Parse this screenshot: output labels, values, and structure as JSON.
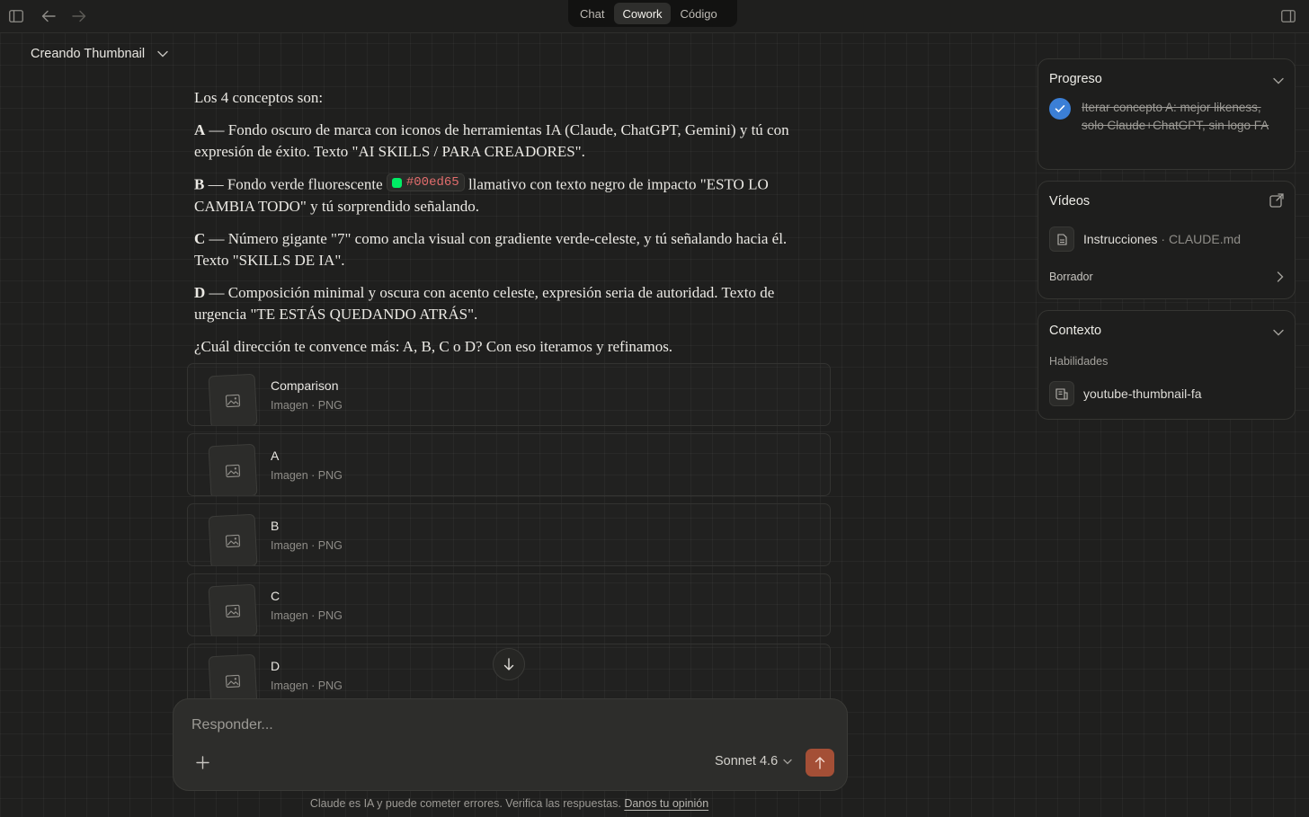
{
  "topbar": {
    "tabs": [
      {
        "label": "Chat",
        "active": false
      },
      {
        "label": "Cowork",
        "active": true
      },
      {
        "label": "Código",
        "active": false
      }
    ]
  },
  "conversation": {
    "title": "Creando Thumbnail"
  },
  "message": {
    "intro": "Los 4 conceptos son:",
    "concepts": [
      {
        "letter": "A",
        "text": " — Fondo oscuro de marca con iconos de herramientas IA (Claude, ChatGPT, Gemini) y tú con expresión de éxito. Texto \"AI SKILLS / PARA CREADORES\"."
      },
      {
        "letter": "B",
        "text_before": " — Fondo verde fluorescente ",
        "code": "#00ed65",
        "code_color": "#00ed65",
        "text_after": " llamativo con texto negro de impacto \"ESTO LO CAMBIA TODO\" y tú sorprendido señalando."
      },
      {
        "letter": "C",
        "text": " — Número gigante \"7\" como ancla visual con gradiente verde-celeste, y tú señalando hacia él. Texto \"SKILLS DE IA\"."
      },
      {
        "letter": "D",
        "text": " — Composición minimal y oscura con acento celeste, expresión seria de autoridad. Texto de urgencia \"TE ESTÁS QUEDANDO ATRÁS\"."
      }
    ],
    "question": "¿Cuál dirección te convence más: A, B, C o D? Con eso iteramos y refinamos."
  },
  "attachments": [
    {
      "name": "Comparison",
      "meta": "Imagen · PNG"
    },
    {
      "name": "A",
      "meta": "Imagen · PNG"
    },
    {
      "name": "B",
      "meta": "Imagen · PNG"
    },
    {
      "name": "C",
      "meta": "Imagen · PNG"
    },
    {
      "name": "D",
      "meta": "Imagen · PNG"
    }
  ],
  "composer": {
    "placeholder": "Responder...",
    "model": "Sonnet 4.6"
  },
  "footer": {
    "note": "Claude es IA y puede cometer errores. Verifica las respuestas.",
    "link": "Danos tu opinión"
  },
  "sidebar": {
    "progress": {
      "title": "Progreso",
      "task": "Iterar concepto A: mejor likeness, solo Claude+ChatGPT, sin logo FA",
      "done": true
    },
    "videos": {
      "title": "Vídeos",
      "file_name": "Instrucciones",
      "file_sep": " · ",
      "file_detail": "CLAUDE.md",
      "draft": "Borrador"
    },
    "context": {
      "title": "Contexto",
      "skills_label": "Habilidades",
      "skill": "youtube-thumbnail-fa"
    }
  },
  "colors": {
    "accent_send": "#a44f36",
    "check": "#3b7fd6",
    "code_text": "#e36d6d"
  }
}
